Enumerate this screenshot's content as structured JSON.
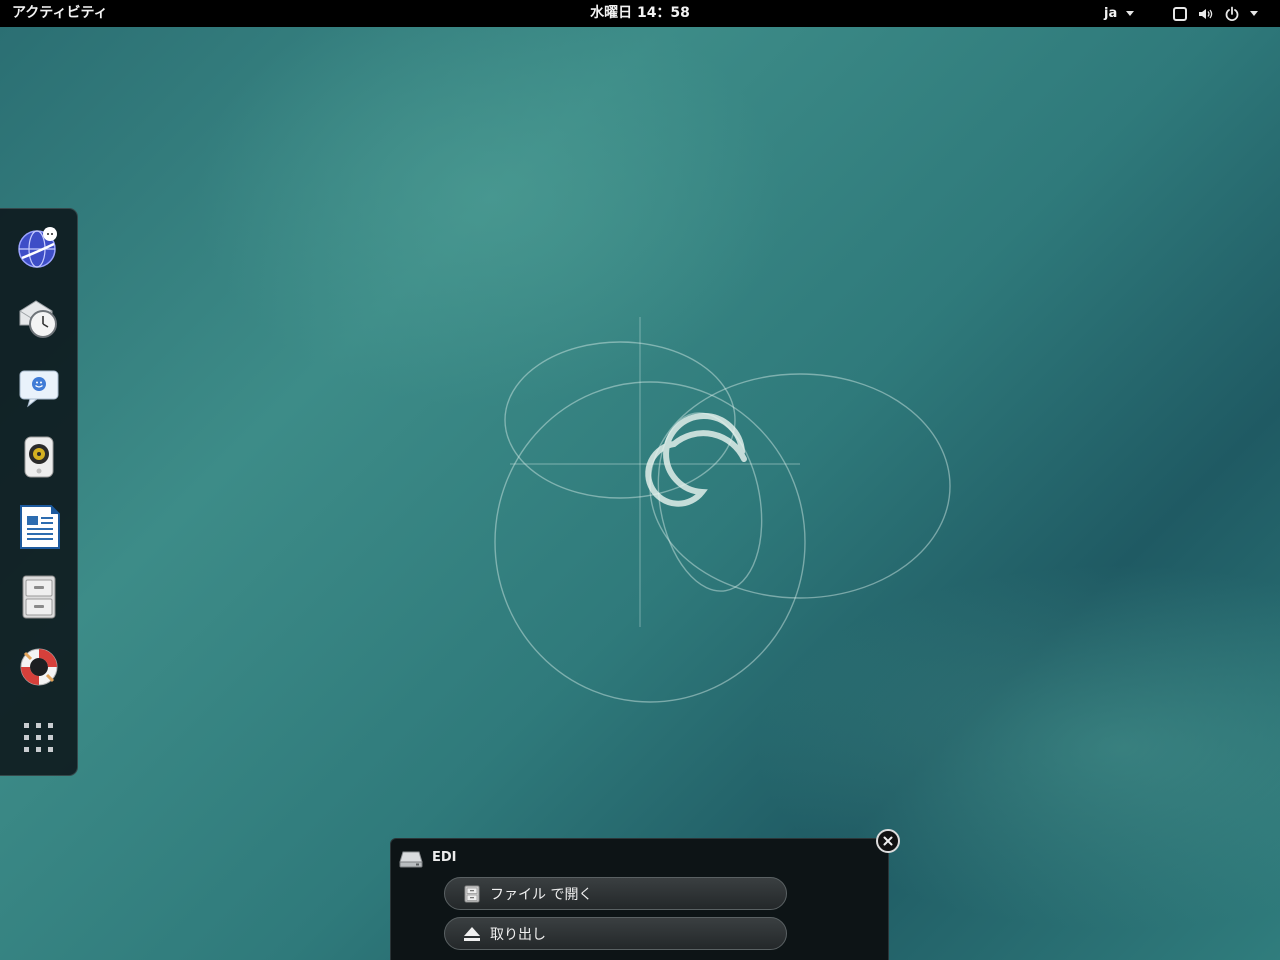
{
  "topbar": {
    "activities_label": "アクティビティ",
    "clock": "水曜日 14：58",
    "language": "ja",
    "system_icons": [
      "screen-icon",
      "volume-icon",
      "power-icon"
    ]
  },
  "dash": {
    "items": [
      {
        "name": "web-browser",
        "icon": "globe-icon"
      },
      {
        "name": "mail-calendar",
        "icon": "mail-clock-icon"
      },
      {
        "name": "messaging",
        "icon": "chat-icon"
      },
      {
        "name": "music-player",
        "icon": "speaker-icon"
      },
      {
        "name": "writer",
        "icon": "document-icon"
      },
      {
        "name": "files",
        "icon": "file-cabinet-icon"
      },
      {
        "name": "help",
        "icon": "lifebuoy-icon"
      },
      {
        "name": "show-applications",
        "icon": "grid-icon"
      }
    ]
  },
  "notification": {
    "title": "EDI",
    "icon": "drive-icon",
    "buttons": {
      "open_label": "ファイル で開く",
      "eject_label": "取り出し"
    }
  },
  "colors": {
    "topbar": "#000000",
    "desktop_teal": "#2f7a7b",
    "dash_bg": "#0c161a",
    "notification_bg": "#0d1416"
  }
}
